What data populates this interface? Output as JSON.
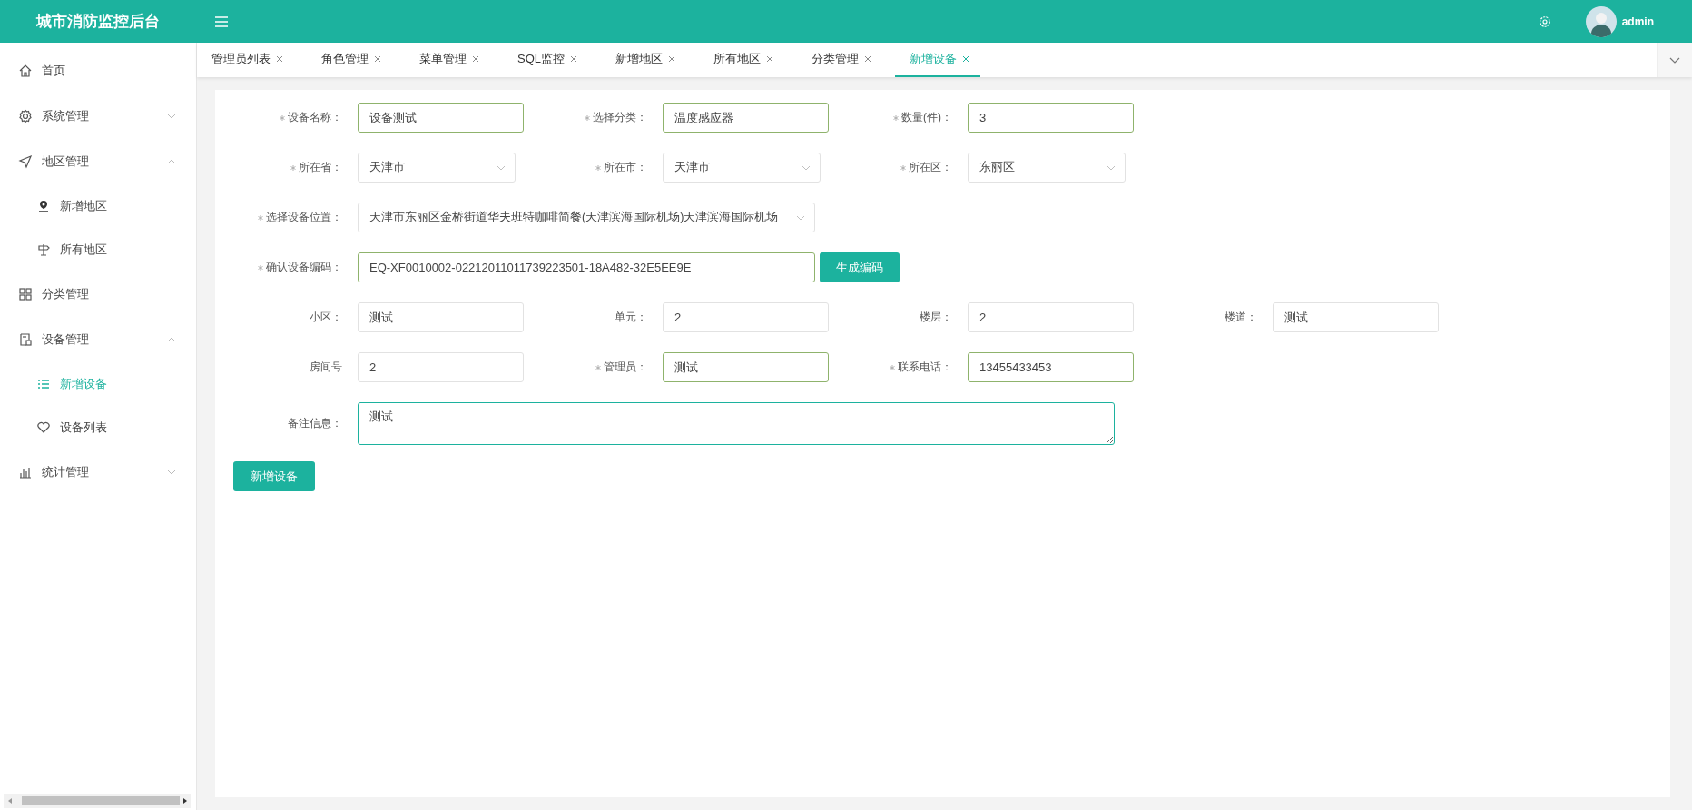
{
  "header": {
    "title": "城市消防监控后台",
    "user": "admin"
  },
  "sidebar": {
    "items": [
      {
        "label": "首页",
        "selected": false
      },
      {
        "label": "系统管理",
        "selected": false,
        "expanded": false
      },
      {
        "label": "地区管理",
        "selected": false,
        "expanded": true,
        "children": [
          {
            "label": "新增地区",
            "selected": false
          },
          {
            "label": "所有地区",
            "selected": false
          }
        ]
      },
      {
        "label": "分类管理",
        "selected": false
      },
      {
        "label": "设备管理",
        "selected": false,
        "expanded": true,
        "children": [
          {
            "label": "新增设备",
            "selected": true
          },
          {
            "label": "设备列表",
            "selected": false
          }
        ]
      },
      {
        "label": "统计管理",
        "selected": false,
        "expanded": false
      }
    ]
  },
  "tabs": [
    {
      "label": "管理员列表",
      "selected": false
    },
    {
      "label": "角色管理",
      "selected": false
    },
    {
      "label": "菜单管理",
      "selected": false
    },
    {
      "label": "SQL监控",
      "selected": false
    },
    {
      "label": "新增地区",
      "selected": false
    },
    {
      "label": "所有地区",
      "selected": false
    },
    {
      "label": "分类管理",
      "selected": false
    },
    {
      "label": "新增设备",
      "selected": true
    }
  ],
  "form": {
    "rows": [
      {
        "fields": [
          {
            "kind": "input",
            "label": "设备名称：",
            "required": true,
            "value": "设备测试",
            "valid": true
          },
          {
            "kind": "input",
            "label": "选择分类：",
            "required": true,
            "value": "温度感应器",
            "valid": true
          },
          {
            "kind": "input",
            "label": "数量(件)：",
            "required": true,
            "value": "3",
            "valid": true
          }
        ]
      },
      {
        "fields": [
          {
            "kind": "select",
            "label": "所在省：",
            "required": true,
            "value": "天津市",
            "valid": false
          },
          {
            "kind": "select",
            "label": "所在市：",
            "required": true,
            "value": "天津市",
            "valid": false
          },
          {
            "kind": "select",
            "label": "所在区：",
            "required": true,
            "value": "东丽区",
            "valid": false
          }
        ]
      },
      {
        "fields": [
          {
            "kind": "wide-select",
            "label": "选择设备位置：",
            "required": true,
            "value": "天津市东丽区金桥街道华夫班特咖啡简餐(天津滨海国际机场)天津滨海国际机场",
            "valid": false
          }
        ]
      },
      {
        "fields": [
          {
            "kind": "code",
            "label": "确认设备编码：",
            "required": true,
            "value": "EQ-XF0010002-02212011011739223501-18A482-32E5EE9E",
            "valid": true,
            "action": "生成编码"
          }
        ]
      },
      {
        "fields": [
          {
            "kind": "input",
            "label": "小区：",
            "required": false,
            "value": "测试",
            "valid": false
          },
          {
            "kind": "input",
            "label": "单元：",
            "required": false,
            "value": "2",
            "valid": false
          },
          {
            "kind": "input",
            "label": "楼层：",
            "required": false,
            "value": "2",
            "valid": false
          },
          {
            "kind": "input",
            "label": "楼道：",
            "required": false,
            "value": "测试",
            "valid": false
          }
        ]
      },
      {
        "fields": [
          {
            "kind": "input",
            "label": "房间号",
            "required": false,
            "value": "2",
            "valid": false
          },
          {
            "kind": "input",
            "label": "管理员：",
            "required": true,
            "value": "测试",
            "valid": true
          },
          {
            "kind": "input",
            "label": "联系电话：",
            "required": true,
            "value": "13455433453",
            "valid": true
          }
        ]
      },
      {
        "fields": [
          {
            "kind": "textarea",
            "label": "备注信息：",
            "required": false,
            "value": "测试",
            "valid": true
          }
        ]
      }
    ],
    "submit": "新增设备"
  }
}
